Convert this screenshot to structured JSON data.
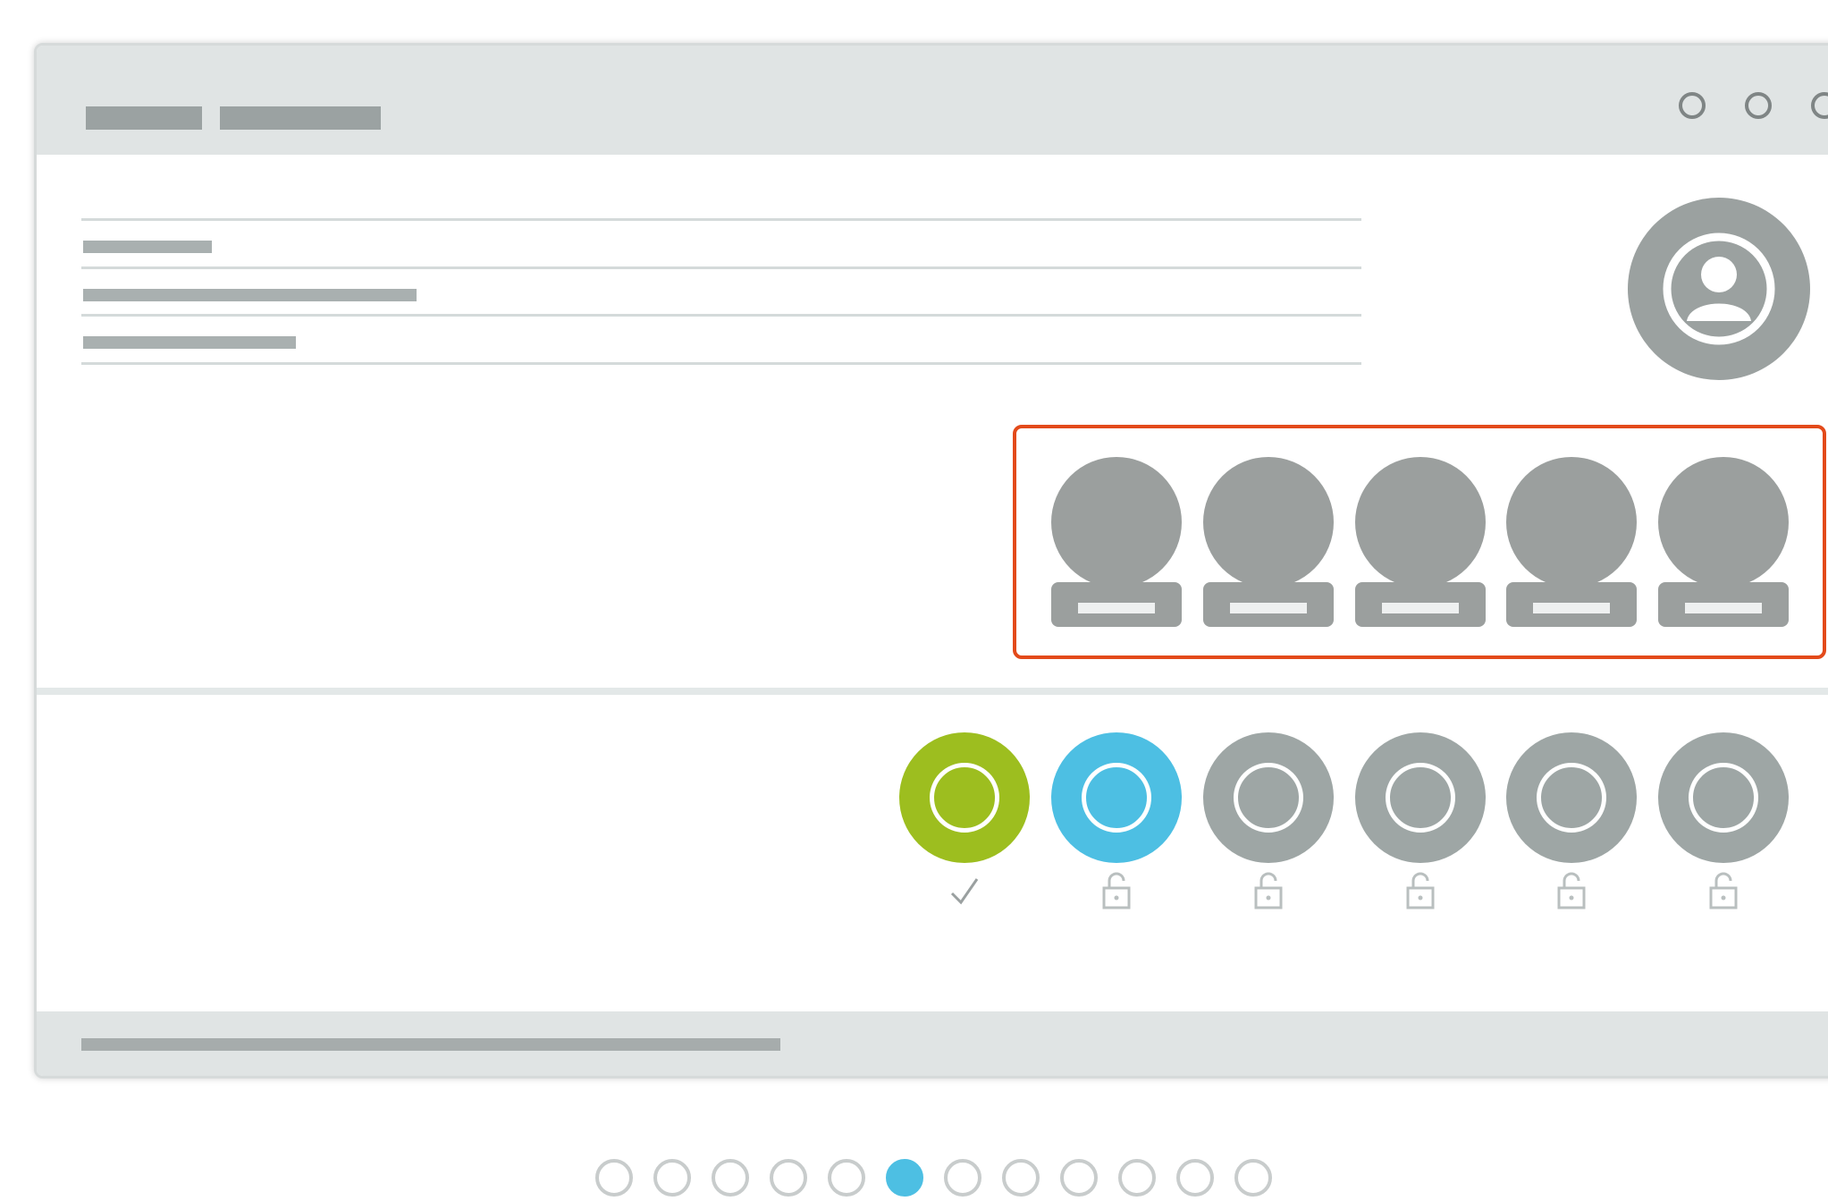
{
  "window": {
    "controls": [
      {
        "name": "window-control-1"
      },
      {
        "name": "window-control-2"
      },
      {
        "name": "window-control-3"
      }
    ]
  },
  "icons": {
    "profile": "user-avatar-icon",
    "badge": "badge-placeholder-icon",
    "completed": "checkmark-icon",
    "locked": "lock-icon"
  },
  "levels": [
    {
      "state": "completed",
      "color": "#9dbe1f",
      "status_icon": "checkmark-icon"
    },
    {
      "state": "current",
      "color": "#4dbfe3",
      "status_icon": "lock-icon"
    },
    {
      "state": "locked",
      "color": "#9ea6a5",
      "status_icon": "lock-icon"
    },
    {
      "state": "locked",
      "color": "#9ea6a5",
      "status_icon": "lock-icon"
    },
    {
      "state": "locked",
      "color": "#9ea6a5",
      "status_icon": "lock-icon"
    },
    {
      "state": "locked",
      "color": "#9ea6a5",
      "status_icon": "lock-icon"
    }
  ],
  "badges_count_shown": 5,
  "highlight_color": "#e34a1a",
  "pagination": {
    "total": 12,
    "current": 6,
    "active_color": "#4dbfe3"
  }
}
